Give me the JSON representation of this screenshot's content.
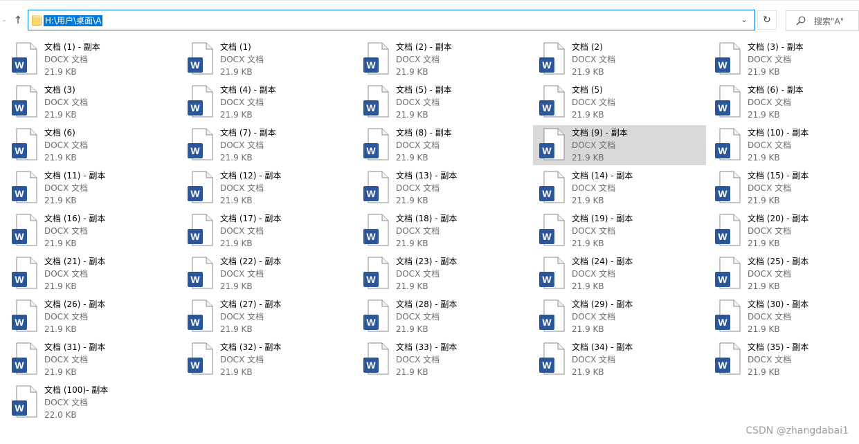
{
  "address": {
    "path": "H:\\用户\\桌面\\A"
  },
  "search": {
    "placeholder": "搜索\"A\""
  },
  "icons": {
    "nav_down": "chevron-down-icon",
    "nav_up": "arrow-up-icon",
    "folder": "folder-icon",
    "dropdown": "chevron-down-icon",
    "refresh": "refresh-icon",
    "search": "search-icon",
    "file": "word-document-icon"
  },
  "colors": {
    "accent": "#0078d7",
    "word_blue": "#2b579a",
    "selected_bg": "#d9d9d9",
    "secondary_text": "#6d6d6d"
  },
  "files": [
    {
      "name": "文档 (1) - 副本",
      "type": "DOCX 文档",
      "size": "21.9 KB"
    },
    {
      "name": "文档 (1)",
      "type": "DOCX 文档",
      "size": "21.9 KB"
    },
    {
      "name": "文档 (2) - 副本",
      "type": "DOCX 文档",
      "size": "21.9 KB"
    },
    {
      "name": "文档 (2)",
      "type": "DOCX 文档",
      "size": "21.9 KB"
    },
    {
      "name": "文档 (3) - 副本",
      "type": "DOCX 文档",
      "size": "21.9 KB"
    },
    {
      "name": "文档 (3)",
      "type": "DOCX 文档",
      "size": "21.9 KB"
    },
    {
      "name": "文档 (4) - 副本",
      "type": "DOCX 文档",
      "size": "21.9 KB"
    },
    {
      "name": "文档 (5) - 副本",
      "type": "DOCX 文档",
      "size": "21.9 KB"
    },
    {
      "name": "文档 (5)",
      "type": "DOCX 文档",
      "size": "21.9 KB"
    },
    {
      "name": "文档 (6) - 副本",
      "type": "DOCX 文档",
      "size": "21.9 KB"
    },
    {
      "name": "文档 (6)",
      "type": "DOCX 文档",
      "size": "21.9 KB"
    },
    {
      "name": "文档 (7) - 副本",
      "type": "DOCX 文档",
      "size": "21.9 KB"
    },
    {
      "name": "文档 (8) - 副本",
      "type": "DOCX 文档",
      "size": "21.9 KB"
    },
    {
      "name": "文档 (9) - 副本",
      "type": "DOCX 文档",
      "size": "21.9 KB",
      "selected": true
    },
    {
      "name": "文档 (10) - 副本",
      "type": "DOCX 文档",
      "size": "21.9 KB"
    },
    {
      "name": "文档 (11) - 副本",
      "type": "DOCX 文档",
      "size": "21.9 KB"
    },
    {
      "name": "文档 (12) - 副本",
      "type": "DOCX 文档",
      "size": "21.9 KB"
    },
    {
      "name": "文档 (13) - 副本",
      "type": "DOCX 文档",
      "size": "21.9 KB"
    },
    {
      "name": "文档 (14) - 副本",
      "type": "DOCX 文档",
      "size": "21.9 KB"
    },
    {
      "name": "文档 (15) - 副本",
      "type": "DOCX 文档",
      "size": "21.9 KB"
    },
    {
      "name": "文档 (16) - 副本",
      "type": "DOCX 文档",
      "size": "21.9 KB"
    },
    {
      "name": "文档 (17) - 副本",
      "type": "DOCX 文档",
      "size": "21.9 KB"
    },
    {
      "name": "文档 (18) - 副本",
      "type": "DOCX 文档",
      "size": "21.9 KB"
    },
    {
      "name": "文档 (19) - 副本",
      "type": "DOCX 文档",
      "size": "21.9 KB"
    },
    {
      "name": "文档 (20) - 副本",
      "type": "DOCX 文档",
      "size": "21.9 KB"
    },
    {
      "name": "文档 (21) - 副本",
      "type": "DOCX 文档",
      "size": "21.9 KB"
    },
    {
      "name": "文档 (22) - 副本",
      "type": "DOCX 文档",
      "size": "21.9 KB"
    },
    {
      "name": "文档 (23) - 副本",
      "type": "DOCX 文档",
      "size": "21.9 KB"
    },
    {
      "name": "文档 (24) - 副本",
      "type": "DOCX 文档",
      "size": "21.9 KB"
    },
    {
      "name": "文档 (25) - 副本",
      "type": "DOCX 文档",
      "size": "21.9 KB"
    },
    {
      "name": "文档 (26) - 副本",
      "type": "DOCX 文档",
      "size": "21.9 KB"
    },
    {
      "name": "文档 (27) - 副本",
      "type": "DOCX 文档",
      "size": "21.9 KB"
    },
    {
      "name": "文档 (28) - 副本",
      "type": "DOCX 文档",
      "size": "21.9 KB"
    },
    {
      "name": "文档 (29) - 副本",
      "type": "DOCX 文档",
      "size": "21.9 KB"
    },
    {
      "name": "文档 (30) - 副本",
      "type": "DOCX 文档",
      "size": "21.9 KB"
    },
    {
      "name": "文档 (31) - 副本",
      "type": "DOCX 文档",
      "size": "21.9 KB"
    },
    {
      "name": "文档 (32) - 副本",
      "type": "DOCX 文档",
      "size": "21.9 KB"
    },
    {
      "name": "文档 (33) - 副本",
      "type": "DOCX 文档",
      "size": "21.9 KB"
    },
    {
      "name": "文档 (34) - 副本",
      "type": "DOCX 文档",
      "size": "21.9 KB"
    },
    {
      "name": "文档 (35) - 副本",
      "type": "DOCX 文档",
      "size": "21.9 KB"
    },
    {
      "name": "文档 (100)- 副本",
      "type": "DOCX 文档",
      "size": "22.0 KB"
    }
  ],
  "watermark": "CSDN @zhangdabai1"
}
